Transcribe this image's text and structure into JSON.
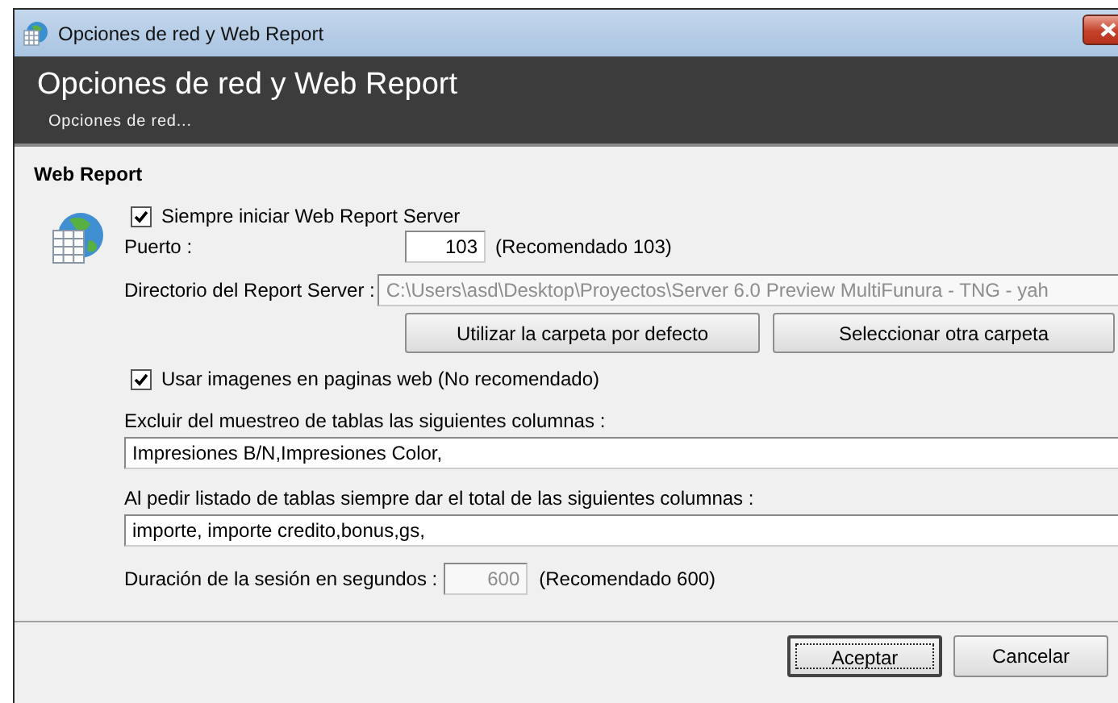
{
  "window": {
    "title": "Opciones de red y Web Report"
  },
  "header": {
    "title": "Opciones de red y Web Report",
    "subtitle": "Opciones de red..."
  },
  "section": {
    "title": "Web Report"
  },
  "options": [
    {
      "kind": "checkbox",
      "label": "Siempre iniciar Web Report Server",
      "checked": true
    },
    {
      "kind": "port",
      "label": "Puerto :",
      "value": "103",
      "note": "(Recomendado 103)",
      "disabled": false
    },
    {
      "kind": "path",
      "label": "Directorio del Report Server :",
      "value": "C:\\Users\\asd\\Desktop\\Proyectos\\Server 6.0 Preview MultiFunura - TNG - yah",
      "disabled": true,
      "buttons": [
        "Utilizar la carpeta por defecto",
        "Seleccionar otra carpeta"
      ]
    },
    {
      "kind": "checkbox",
      "label": "Usar imagenes en paginas web (No recomendado)",
      "checked": true
    },
    {
      "kind": "text",
      "label": "Excluir del muestreo de tablas las siguientes columnas :",
      "value": "Impresiones B/N,Impresiones Color,"
    },
    {
      "kind": "text",
      "label": "Al pedir listado de tablas siempre dar el total de las siguientes columnas :",
      "value": "importe, importe credito,bonus,gs,"
    },
    {
      "kind": "inline-number",
      "label": "Duración de la sesión en segundos :",
      "value": "600",
      "note": "(Recomendado 600)",
      "disabled": true
    }
  ],
  "buttons": [
    {
      "label": "Aceptar",
      "focused": true
    },
    {
      "label": "Cancelar",
      "focused": false
    }
  ]
}
